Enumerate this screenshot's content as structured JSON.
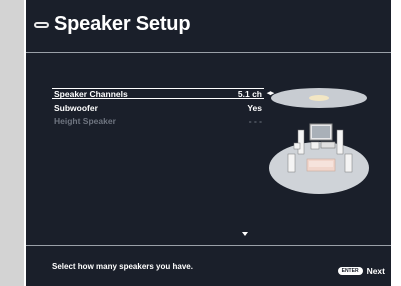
{
  "header": {
    "title": "Speaker Setup",
    "icon": "remote-icon"
  },
  "menu": {
    "items": [
      {
        "label": "Speaker Channels",
        "value": "5.1 ch",
        "selected": true,
        "enabled": true
      },
      {
        "label": "Subwoofer",
        "value": "Yes",
        "selected": false,
        "enabled": true
      },
      {
        "label": "Height Speaker",
        "value": "- - -",
        "selected": false,
        "enabled": false
      }
    ]
  },
  "footer": {
    "hint": "Select how many speakers you have.",
    "enter_badge": "ENTER",
    "next_label": "Next"
  },
  "colors": {
    "background": "#1a1f2a",
    "text": "#ffffff",
    "disabled": "#6f7580",
    "frame": "#d3d3d3"
  }
}
